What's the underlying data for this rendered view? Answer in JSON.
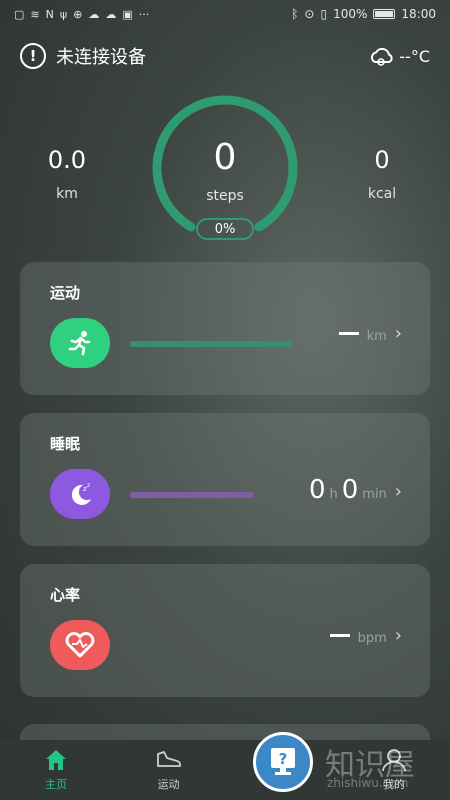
{
  "status_bar": {
    "battery": "100%",
    "time": "18:00"
  },
  "header": {
    "title": "未连接设备",
    "temperature": "--°C"
  },
  "summary": {
    "distance_value": "0.0",
    "distance_unit": "km",
    "steps_value": "0",
    "steps_unit": "steps",
    "steps_percent": "0%",
    "calories_value": "0",
    "calories_unit": "kcal"
  },
  "cards": {
    "exercise": {
      "title": "运动",
      "unit": "km",
      "color": "#2fd07f",
      "bar_color": "#3b8d70"
    },
    "sleep": {
      "title": "睡眠",
      "hours": "0",
      "hours_unit": "h",
      "minutes": "0",
      "minutes_unit": "min",
      "color": "#8d59e0",
      "bar_color": "#7f5ea6"
    },
    "heart_rate": {
      "title": "心率",
      "unit": "bpm",
      "color": "#ef5a5a"
    }
  },
  "bottom_nav": {
    "home_label": "主页",
    "sport_label": "运动",
    "mine_label": "我的"
  },
  "watermark": {
    "cn": "知识屋",
    "en": "zhishiwu.com"
  },
  "colors": {
    "accent_green": "#25c58a",
    "ring_green": "#2f9b70"
  }
}
